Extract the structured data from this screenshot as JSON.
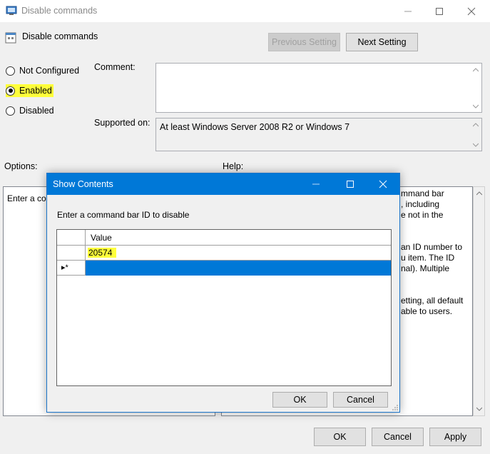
{
  "window": {
    "title": "Disable commands",
    "setting_name": "Disable commands",
    "prev_button": "Previous Setting",
    "next_button": "Next Setting"
  },
  "state": {
    "options": [
      "Not Configured",
      "Enabled",
      "Disabled"
    ],
    "selected": "Enabled"
  },
  "comment_label": "Comment:",
  "supported_label": "Supported on:",
  "supported_value": "At least Windows Server 2008 R2 or Windows 7",
  "options_label": "Options:",
  "help_label": "Help:",
  "options_text_partial": "Enter a co",
  "help_fragments": [
    "mmand bar",
    ", including",
    "e not in the",
    "an ID number to",
    "u item.  The ID",
    "nal).  Multiple",
    "etting, all default",
    "able to users."
  ],
  "footer": {
    "ok": "OK",
    "cancel": "Cancel",
    "apply": "Apply"
  },
  "dialog": {
    "title": "Show Contents",
    "instruction": "Enter a command bar ID to disable",
    "column_header": "Value",
    "rows": [
      {
        "value": "20574"
      }
    ],
    "new_row_marker": "▸*",
    "ok": "OK",
    "cancel": "Cancel"
  },
  "colors": {
    "accent": "#0078d7",
    "highlight": "#ffff3a"
  }
}
